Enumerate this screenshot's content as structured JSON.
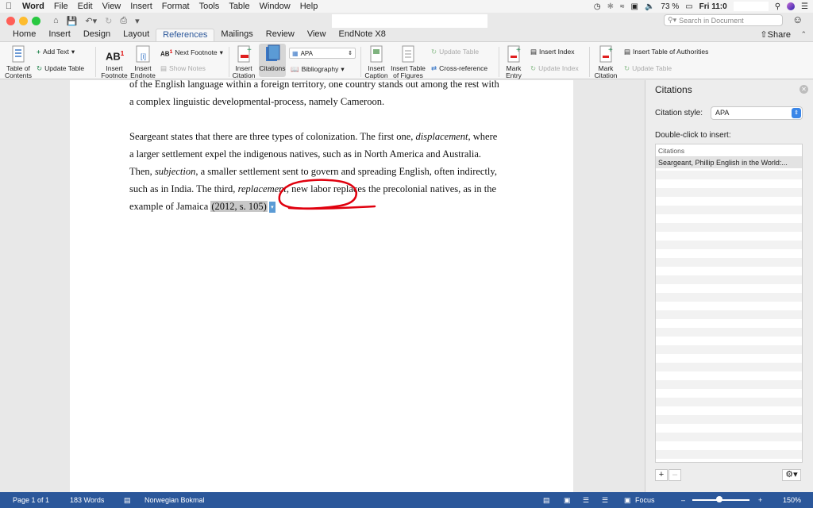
{
  "menubar": {
    "app": "Word",
    "items": [
      "File",
      "Edit",
      "View",
      "Insert",
      "Format",
      "Tools",
      "Table",
      "Window",
      "Help"
    ],
    "battery": "73 %",
    "clock": "Fri 11:0"
  },
  "search": {
    "placeholder": "Search in Document"
  },
  "tabs": [
    "Home",
    "Insert",
    "Design",
    "Layout",
    "References",
    "Mailings",
    "Review",
    "View",
    "EndNote X8"
  ],
  "active_tab": "References",
  "share_label": "Share",
  "ribbon": {
    "toc_label_1": "Table of",
    "toc_label_2": "Contents",
    "add_text": "Add Text",
    "update_table": "Update Table",
    "insert_footnote_1": "Insert",
    "insert_footnote_2": "Footnote",
    "insert_endnote_1": "Insert",
    "insert_endnote_2": "Endnote",
    "next_footnote": "Next Footnote",
    "show_notes": "Show Notes",
    "insert_citation_1": "Insert",
    "insert_citation_2": "Citation",
    "citations": "Citations",
    "style_value": "APA",
    "bibliography": "Bibliography",
    "insert_caption_1": "Insert",
    "insert_caption_2": "Caption",
    "insert_tof_1": "Insert Table",
    "insert_tof_2": "of Figures",
    "update_table_2": "Update Table",
    "cross_reference": "Cross-reference",
    "mark_entry_1": "Mark",
    "mark_entry_2": "Entry",
    "insert_index": "Insert Index",
    "update_index": "Update Index",
    "mark_citation_1": "Mark",
    "mark_citation_2": "Citation",
    "insert_toa": "Insert Table of Authorities",
    "update_table_3": "Update Table"
  },
  "document": {
    "line1": "of the English language within a foreign territory, one country stands out among the rest with",
    "line2": "a complex linguistic developmental-process, namely Cameroon.",
    "p2_l1_a": "Seargeant states that there are three types of colonization. The first one, ",
    "p2_l1_b": "displacement",
    "p2_l1_c": ", where",
    "p2_l2": "a larger settlement expel the indigenous natives, such as in North America and Australia.",
    "p2_l3_a": "Then, ",
    "p2_l3_b": "subjection",
    "p2_l3_c": ", a smaller settlement sent to govern and spreading English, often indirectly,",
    "p2_l4_a": "such as in India. The third, ",
    "p2_l4_b": "replacement",
    "p2_l4_c": ", new labor replaces the precolonial natives, as in the",
    "p2_l5_a": "example of Jamaica",
    "citation": "(2012, s. 105)"
  },
  "pane": {
    "title": "Citations",
    "style_label": "Citation style:",
    "style_value": "APA",
    "double_click_label": "Double-click to insert:",
    "list_header": "Citations",
    "items": [
      "Seargeant, Phillip English in the World:..."
    ]
  },
  "statusbar": {
    "page": "Page 1 of 1",
    "words": "183 Words",
    "language": "Norwegian Bokmal",
    "focus": "Focus",
    "zoom": "150%",
    "zoom_level": 0.47
  },
  "colors": {
    "accent": "#2b579a",
    "annotation_red": "#e0000e",
    "citation_highlight": "#c8c8c8"
  }
}
